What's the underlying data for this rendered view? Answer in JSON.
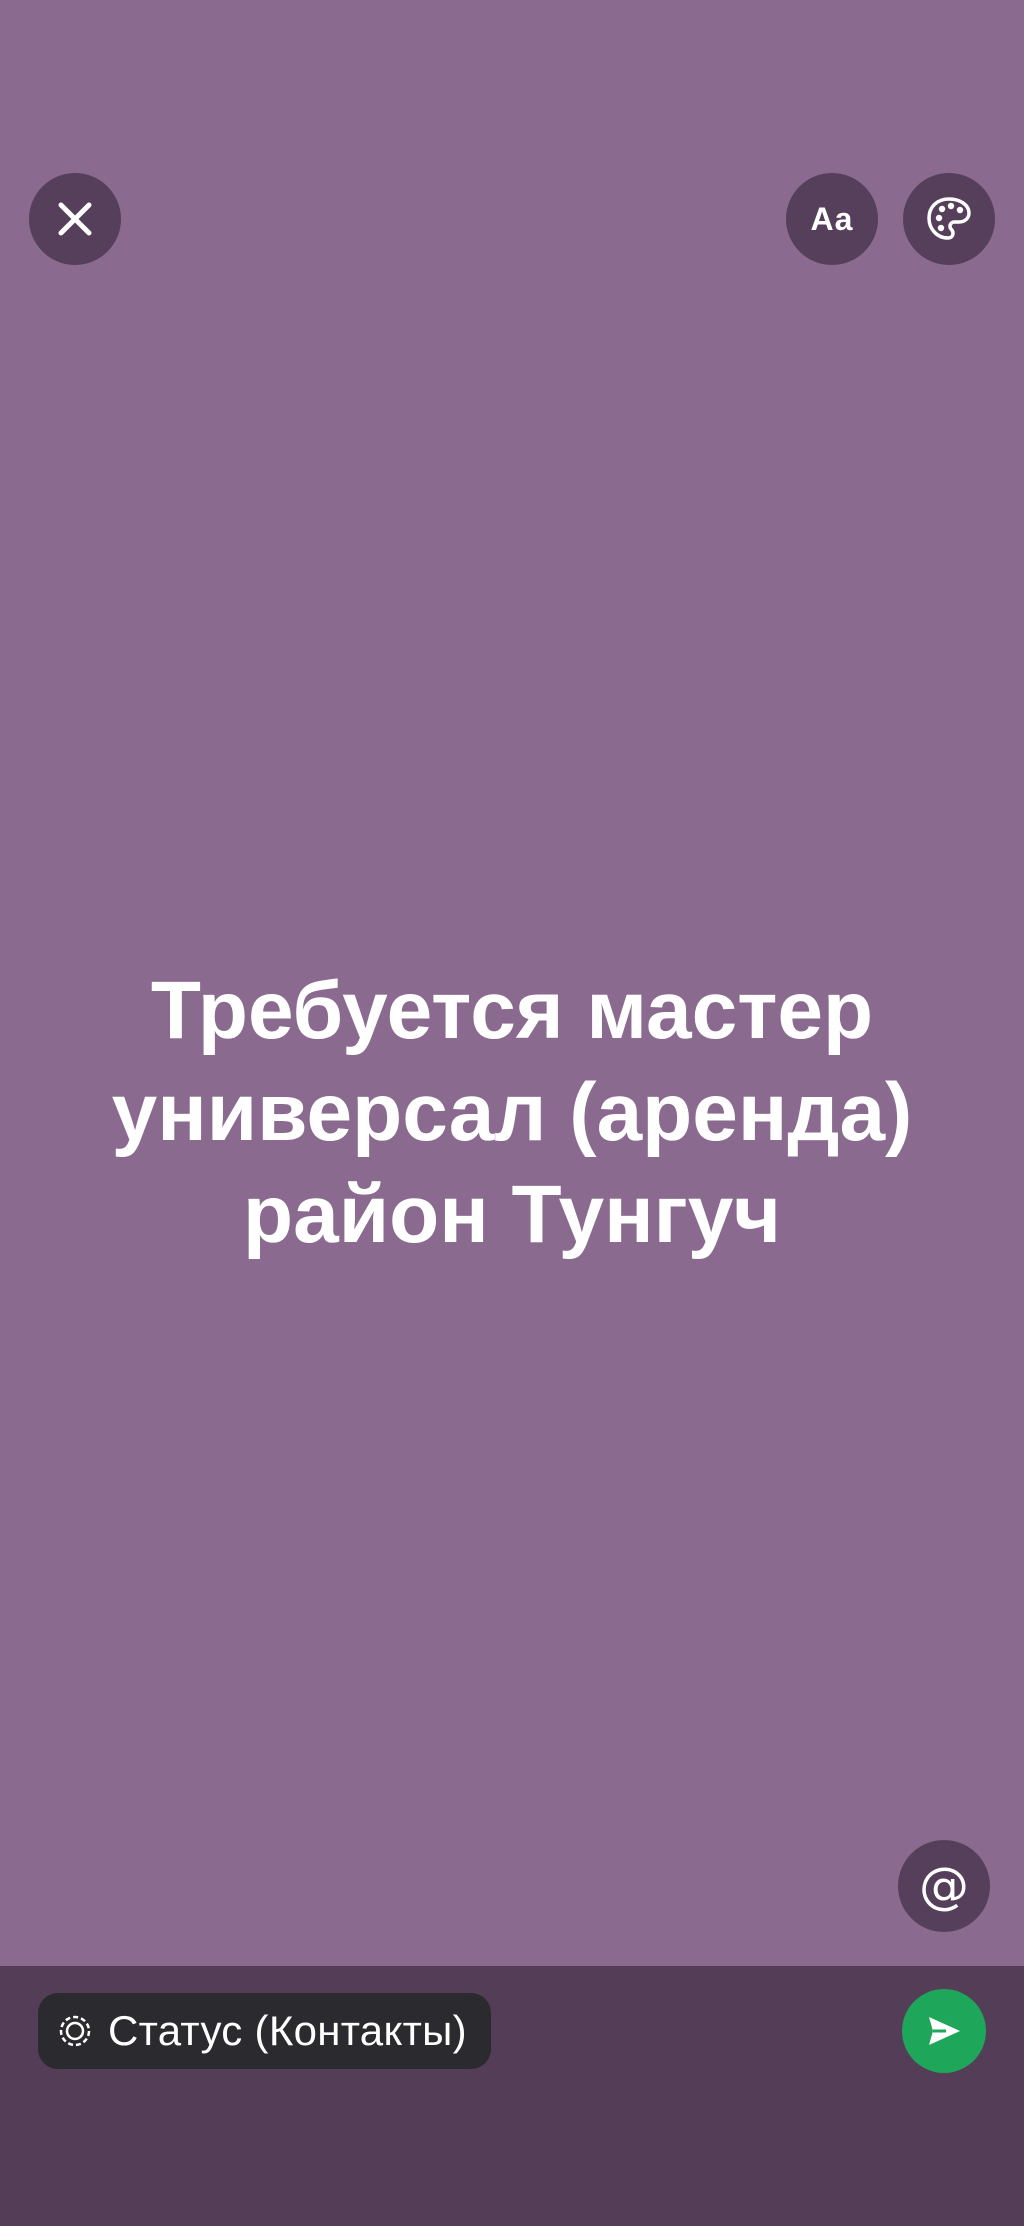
{
  "header": {
    "close_icon": "close-icon",
    "font_button_label": "Aa",
    "palette_icon": "palette-icon"
  },
  "status": {
    "text": "Требуется мастер\nуниверсал  (аренда)\nрайон Тунгуч"
  },
  "mention": {
    "label": "@"
  },
  "footer": {
    "audience_label": "Статус (Контакты)",
    "audience_icon": "status-icon",
    "send_icon": "send-icon"
  },
  "colors": {
    "background": "#8a6a8f",
    "button": "#553f5b",
    "bottom_bar": "#543d57",
    "pill": "#2b2a2e",
    "send": "#1ea65a",
    "text": "#ffffff"
  }
}
